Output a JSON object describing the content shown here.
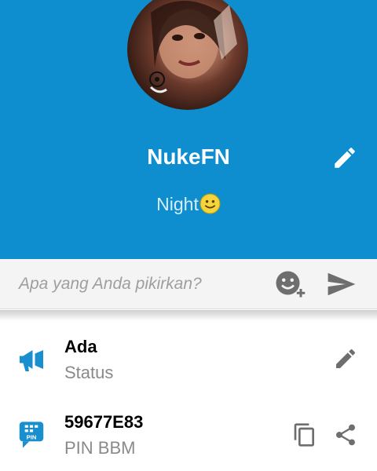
{
  "profile": {
    "name": "NukeFN",
    "status_message": "Night",
    "avatar_icon": "profile-photo"
  },
  "composer": {
    "placeholder": "Apa yang Anda pikirkan?",
    "emoji_icon": "emoji-add-icon",
    "send_icon": "send-icon"
  },
  "details": {
    "availability": {
      "title": "Ada",
      "subtitle": "Status",
      "icon": "megaphone-icon",
      "action_icon": "pencil-icon"
    },
    "pin": {
      "title": "59677E83",
      "subtitle": "PIN BBM",
      "icon": "bbm-pin-icon",
      "badge": "PIN",
      "action_icons": [
        "copy-icon",
        "share-icon"
      ]
    }
  },
  "colors": {
    "header_blue": "#0e8ecf",
    "icon_blue": "#1a8fd0",
    "icon_gray": "#6e6e6e"
  }
}
